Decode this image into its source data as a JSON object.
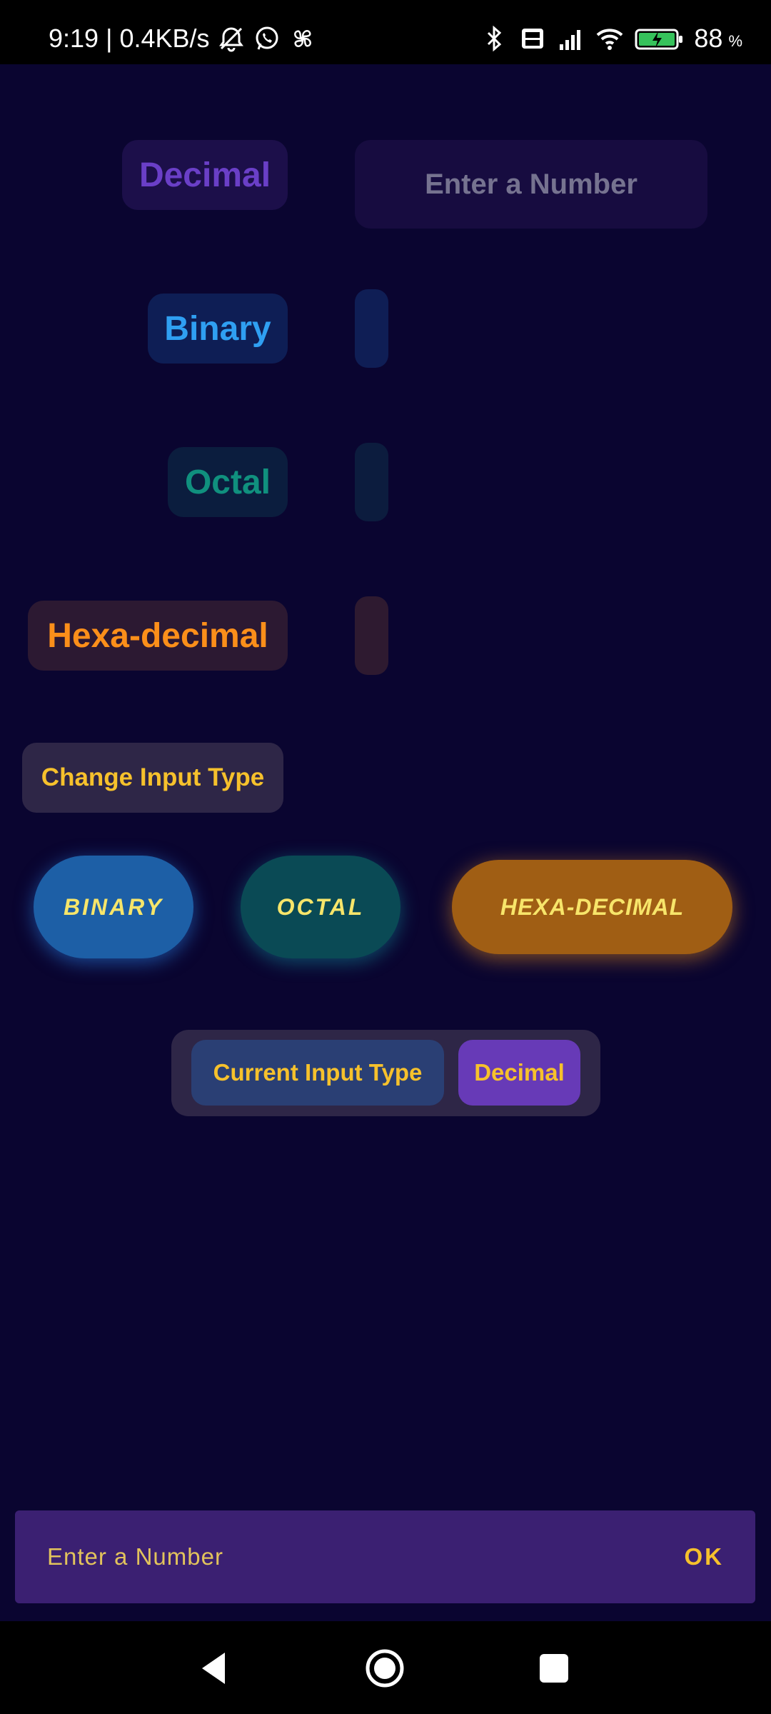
{
  "status_bar": {
    "time": "9:19",
    "separator": "|",
    "network_speed": "0.4KB/s",
    "battery_level": "88",
    "battery_unit": "%",
    "icons": [
      "alarm-off-icon",
      "whatsapp-icon",
      "pinwheel-icon",
      "bluetooth-icon",
      "volte-icon",
      "signal-icon",
      "wifi-icon",
      "battery-charging-icon"
    ]
  },
  "converter": {
    "decimal_label": "Decimal",
    "decimal_placeholder": "Enter a Number",
    "binary_label": "Binary",
    "octal_label": "Octal",
    "hex_label": "Hexa-decimal",
    "binary_result": "",
    "octal_result": "",
    "hex_result": ""
  },
  "input_type": {
    "change_button": "Change Input Type",
    "options": [
      "BINARY",
      "OCTAL",
      "HEXA-DECIMAL"
    ],
    "current_label": "Current Input Type",
    "current_value": "Decimal"
  },
  "bottom_input": {
    "placeholder": "Enter a Number",
    "ok_label": "OK"
  },
  "colors": {
    "background": "#0a0530",
    "decimal": "#6a3fc7",
    "binary": "#2f9ff2",
    "octal": "#10907e",
    "hex": "#fb8f1a",
    "accent_yellow": "#f6c12c"
  },
  "nav_bar": {
    "icons": [
      "back-icon",
      "home-icon",
      "recents-icon"
    ]
  }
}
